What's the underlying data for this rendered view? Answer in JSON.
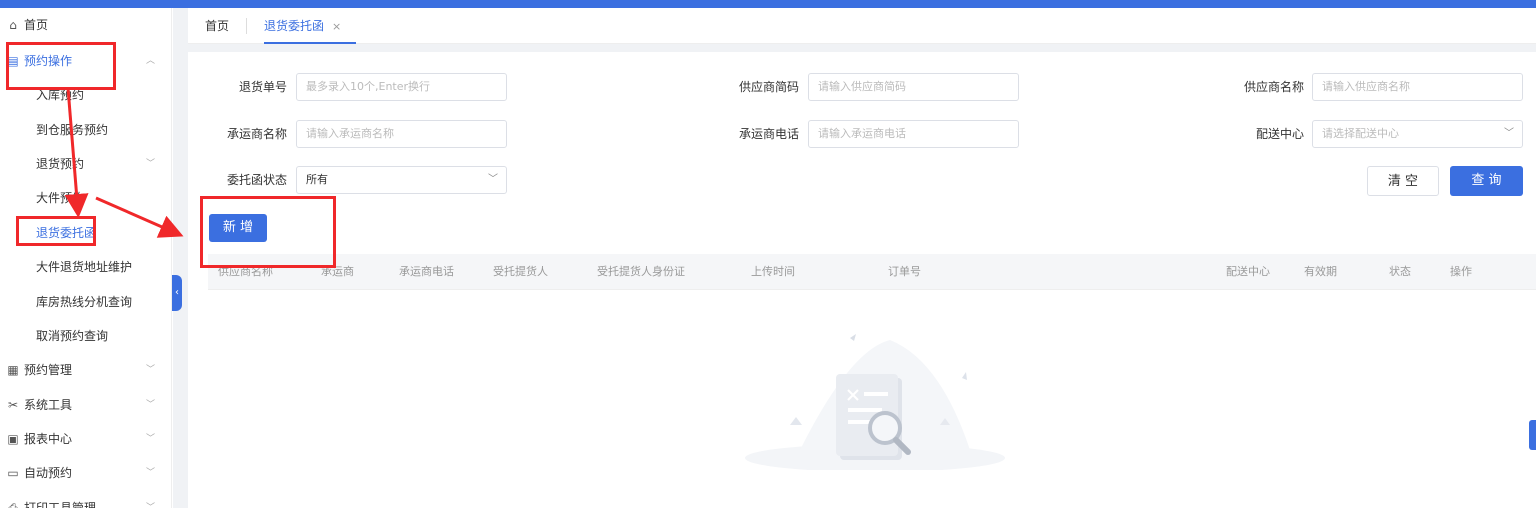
{
  "sidebar": {
    "home": "首页",
    "groups": [
      {
        "label": "预约操作",
        "icon": "calendar-icon"
      },
      {
        "label": "预约管理",
        "icon": "manage-icon"
      },
      {
        "label": "系统工具",
        "icon": "tools-icon"
      },
      {
        "label": "报表中心",
        "icon": "report-icon"
      },
      {
        "label": "自动预约",
        "icon": "monitor-icon"
      },
      {
        "label": "打印工具管理",
        "icon": "printer-icon"
      }
    ],
    "sub_items": [
      {
        "label": "入库预约"
      },
      {
        "label": "到仓服务预约"
      },
      {
        "label": "退货预约"
      },
      {
        "label": "大件预约"
      },
      {
        "label": "退货委托函"
      },
      {
        "label": "大件退货地址维护"
      },
      {
        "label": "库房热线分机查询"
      },
      {
        "label": "取消预约查询"
      }
    ]
  },
  "tabs": {
    "home": "首页",
    "active": "退货委托函",
    "close": "×"
  },
  "form": {
    "return_no_label": "退货单号",
    "return_no_placeholder": "最多录入10个,Enter换行",
    "supplier_code_label": "供应商简码",
    "supplier_code_placeholder": "请输入供应商简码",
    "supplier_name_label": "供应商名称",
    "supplier_name_placeholder": "请输入供应商名称",
    "carrier_name_label": "承运商名称",
    "carrier_name_placeholder": "请输入承运商名称",
    "carrier_phone_label": "承运商电话",
    "carrier_phone_placeholder": "请输入承运商电话",
    "dc_label": "配送中心",
    "dc_placeholder": "请选择配送中心",
    "status_label": "委托函状态",
    "status_value": "所有"
  },
  "buttons": {
    "clear": "清 空",
    "query": "查 询",
    "add": "新 增"
  },
  "table": {
    "columns": [
      "供应商名称",
      "承运商",
      "承运商电话",
      "受托提货人",
      "受托提货人身份证",
      "上传时间",
      "订单号",
      "配送中心",
      "有效期",
      "状态",
      "操作"
    ]
  },
  "colors": {
    "accent": "#3b6fe0",
    "annotation": "#f0282a"
  }
}
